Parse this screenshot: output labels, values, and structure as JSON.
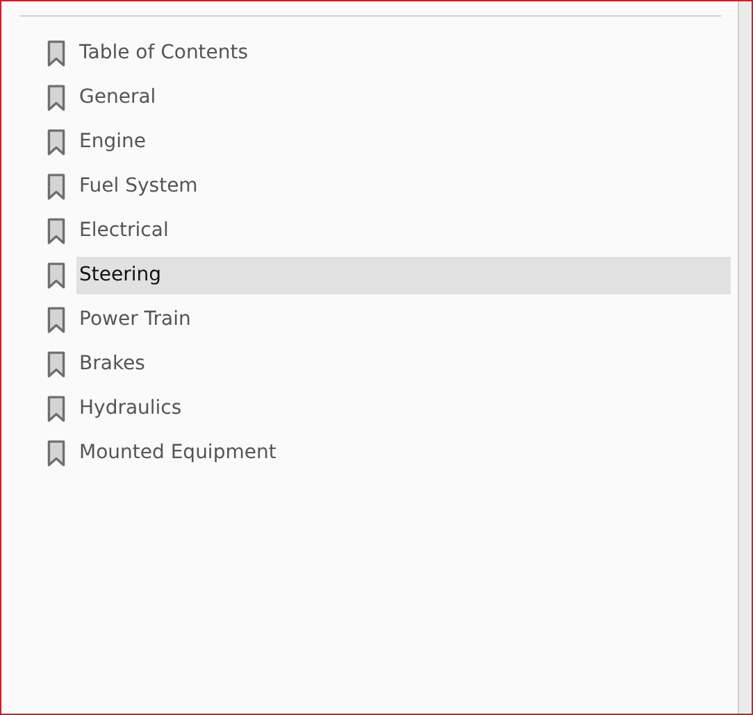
{
  "bookmarks": [
    {
      "label": "Table of Contents",
      "selected": false
    },
    {
      "label": "General",
      "selected": false
    },
    {
      "label": "Engine",
      "selected": false
    },
    {
      "label": "Fuel System",
      "selected": false
    },
    {
      "label": "Electrical",
      "selected": false
    },
    {
      "label": "Steering",
      "selected": true
    },
    {
      "label": "Power Train",
      "selected": false
    },
    {
      "label": "Brakes",
      "selected": false
    },
    {
      "label": "Hydraulics",
      "selected": false
    },
    {
      "label": "Mounted Equipment",
      "selected": false
    }
  ]
}
